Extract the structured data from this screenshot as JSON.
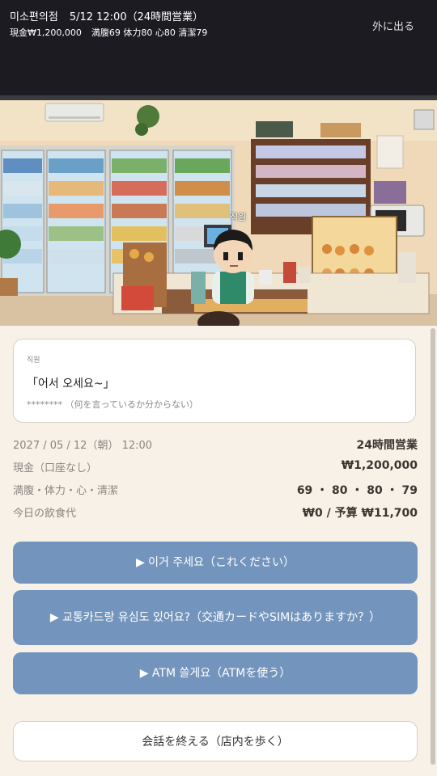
{
  "header": {
    "store_name": "미소편의점",
    "datetime": "5/12 12:00（24時間営業）",
    "cash": "現金₩1,200,000",
    "stats": "満腹69 体力80 心80 清潔79",
    "exit_label": "外に出る"
  },
  "scene": {
    "staff_tag": "직원"
  },
  "speech": {
    "speaker": "직원",
    "korean": "「어서 오세요~」",
    "obscured": "********",
    "translation": "（何を言っているか分からない）"
  },
  "status": {
    "date": "2027 / 05 / 12（朝） 12:00",
    "hours": "24時間営業",
    "cash_label": "現金（口座なし）",
    "cash_value": "₩1,200,000",
    "vitals_label": "満腹・体力・心・清潔",
    "vitals_value": "69 ・ 80 ・ 80 ・ 79",
    "food_label": "今日の飲食代",
    "food_value": "₩0 / 予算 ₩11,700"
  },
  "actions": [
    {
      "label": "▶ 이거 주세요（これください）"
    },
    {
      "label": "▶ 교통카드랑 유심도 있어요?（交通カードやSIMはありますか？）"
    },
    {
      "label": "▶ ATM 쓸게요（ATMを使う）"
    }
  ],
  "end_label": "会話を終える（店内を歩く）"
}
